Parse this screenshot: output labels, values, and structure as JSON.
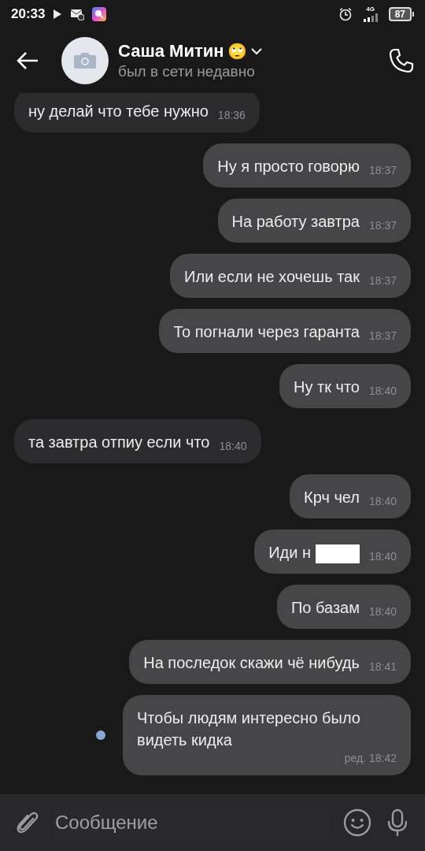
{
  "status_bar": {
    "time": "20:33",
    "network": "4G",
    "battery": "87"
  },
  "header": {
    "name": "Саша Митин",
    "emoji": "🙄",
    "status": "был в сети недавно"
  },
  "messages": [
    {
      "outgoing": false,
      "text": "ну делай что тебе нужно",
      "time": "18:36"
    },
    {
      "outgoing": true,
      "text": "Ну я просто говорю",
      "time": "18:37"
    },
    {
      "outgoing": true,
      "text": "На работу завтра",
      "time": "18:37"
    },
    {
      "outgoing": true,
      "text": "Или если не хочешь так",
      "time": "18:37"
    },
    {
      "outgoing": true,
      "text": "То погнали через гаранта",
      "time": "18:37"
    },
    {
      "outgoing": true,
      "text": "Ну тк что",
      "time": "18:40"
    },
    {
      "outgoing": false,
      "text": "та завтра отпиу если что",
      "time": "18:40"
    },
    {
      "outgoing": true,
      "text": "Крч чел",
      "time": "18:40"
    },
    {
      "outgoing": true,
      "text": "Иди н",
      "time": "18:40",
      "redacted": true
    },
    {
      "outgoing": true,
      "text": "По базам",
      "time": "18:40"
    },
    {
      "outgoing": true,
      "text": "На последок скажи чё нибудь",
      "time": "18:41"
    },
    {
      "outgoing": true,
      "text": "Чтобы людям интересно было видеть кидка",
      "time": "ред. 18:42",
      "unread": true
    }
  ],
  "composer": {
    "placeholder": "Сообщение"
  }
}
